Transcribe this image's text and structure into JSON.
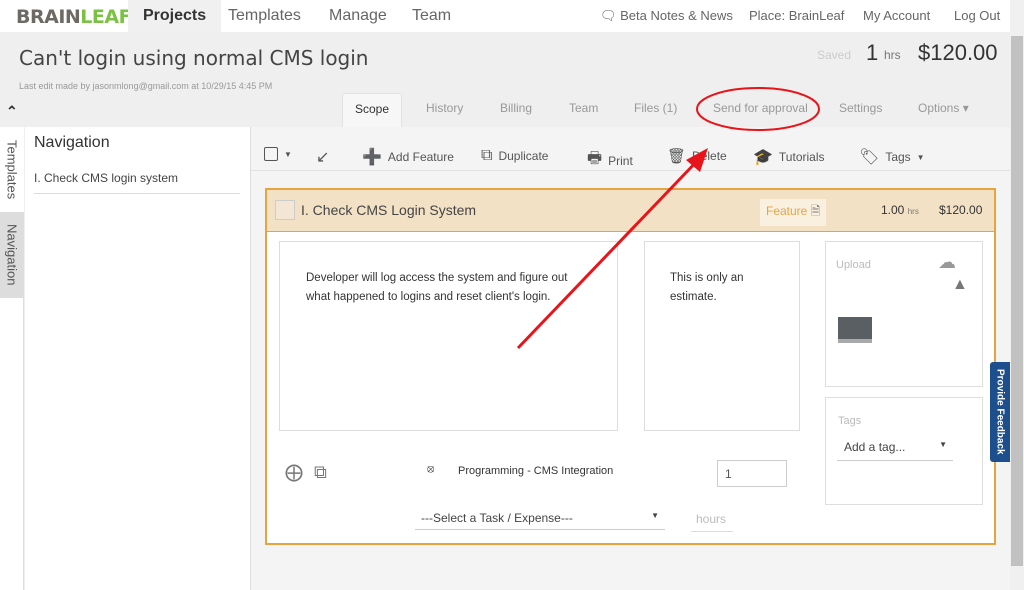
{
  "logo": {
    "part1": "BRAIN",
    "part2": "LEAF"
  },
  "topnav": {
    "tabs": [
      "Projects",
      "Templates",
      "Manage",
      "Team"
    ],
    "beta": "Beta Notes & News",
    "place": "Place: BrainLeaf",
    "account": "My Account",
    "logout": "Log Out"
  },
  "project": {
    "title": "Can't login using normal CMS login",
    "last_edit": "Last edit made by jasonmlong@gmail.com at 10/29/15 4:45 PM",
    "saved": "Saved",
    "hours": "1",
    "hours_unit": "hrs",
    "total": "$120.00"
  },
  "tabs": [
    "Scope",
    "History",
    "Billing",
    "Team",
    "Files (1)",
    "Send for approval",
    "Settings",
    "Options"
  ],
  "side_tabs": [
    "Templates",
    "Navigation"
  ],
  "navigation": {
    "heading": "Navigation",
    "items": [
      "I. Check CMS login system"
    ]
  },
  "toolbar": {
    "add_feature": "Add Feature",
    "duplicate": "Duplicate",
    "print": "Print",
    "delete": "Delete",
    "tutorials": "Tutorials",
    "tags": "Tags"
  },
  "feature": {
    "title": "I. Check CMS Login System",
    "badge": "Feature",
    "hours": "1.00",
    "hours_unit": "hrs",
    "price": "$120.00",
    "description": "Developer will log access the system and figure out what happened to logins and reset client's login.",
    "note": "This is only an estimate.",
    "upload_label": "Upload",
    "tags_label": "Tags",
    "tag_placeholder": "Add a tag...",
    "task_name": "Programming - CMS Integration",
    "task_hours": "1",
    "select_task": "---Select a Task / Expense---",
    "hours_placeholder": "hours"
  },
  "feedback": "Provide Feedback",
  "annotation_color": "#e8141a"
}
